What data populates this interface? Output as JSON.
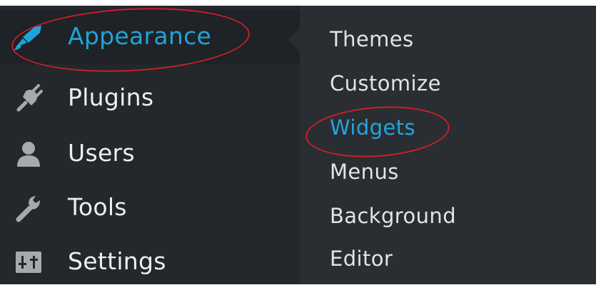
{
  "colors": {
    "sidebar_bg": "#24272b",
    "submenu_bg": "#2a2d31",
    "accent": "#1ea4d9",
    "highlight_circle": "#c8202a"
  },
  "admin_menu": {
    "items": [
      {
        "label": "Appearance",
        "icon": "paintbrush-icon",
        "active": true
      },
      {
        "label": "Plugins",
        "icon": "plugin-icon",
        "active": false
      },
      {
        "label": "Users",
        "icon": "user-icon",
        "active": false
      },
      {
        "label": "Tools",
        "icon": "wrench-icon",
        "active": false
      },
      {
        "label": "Settings",
        "icon": "settings-icon",
        "active": false
      }
    ]
  },
  "submenu": {
    "items": [
      {
        "label": "Themes",
        "current": false
      },
      {
        "label": "Customize",
        "current": false
      },
      {
        "label": "Widgets",
        "current": true
      },
      {
        "label": "Menus",
        "current": false
      },
      {
        "label": "Background",
        "current": false
      },
      {
        "label": "Editor",
        "current": false
      }
    ]
  }
}
